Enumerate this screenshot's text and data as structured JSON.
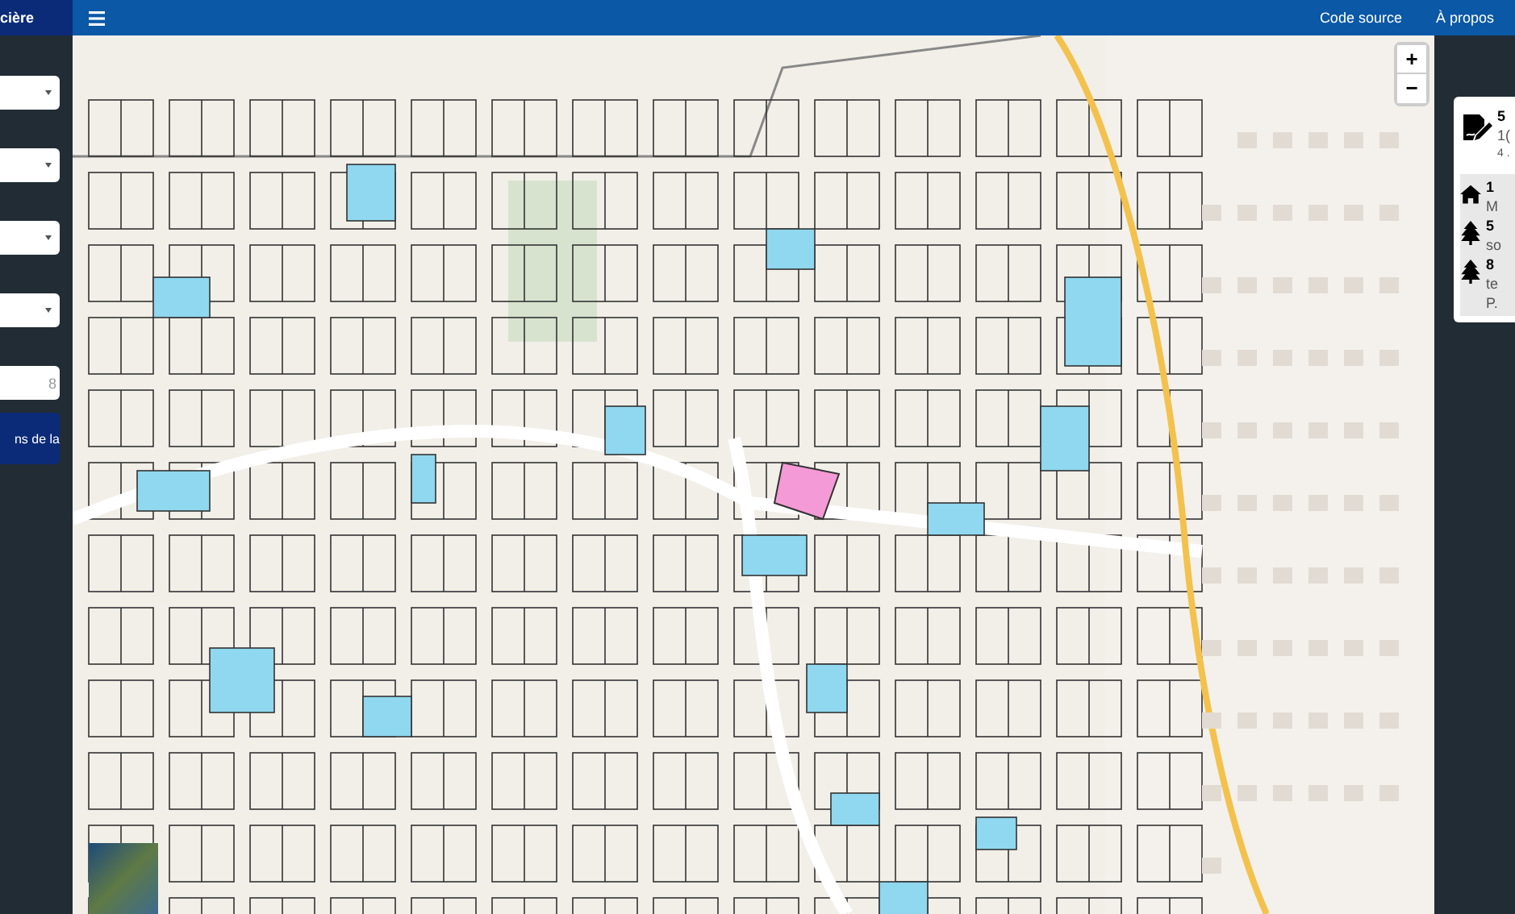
{
  "header": {
    "title": "cière",
    "links": [
      "Code source",
      "À propos"
    ]
  },
  "sidebar": {
    "fields": [
      {
        "kind": "select"
      },
      {
        "kind": "select"
      },
      {
        "kind": "select"
      },
      {
        "kind": "select"
      },
      {
        "kind": "input",
        "placeholder": "8"
      }
    ],
    "button": "ns de la"
  },
  "map": {
    "zoom_in": "+",
    "zoom_out": "−"
  },
  "info_panel": {
    "sections": [
      {
        "shaded": false,
        "rows": [
          {
            "kind": "document-pen",
            "lines": [
              "5",
              "1(",
              "4 ."
            ]
          }
        ]
      },
      {
        "shaded": true,
        "rows": [
          {
            "kind": "house",
            "lines": [
              "1",
              "M"
            ]
          },
          {
            "kind": "tree",
            "lines": [
              "5",
              "so"
            ]
          },
          {
            "kind": "tree",
            "lines": [
              "8",
              "te",
              "P."
            ]
          }
        ]
      }
    ]
  }
}
